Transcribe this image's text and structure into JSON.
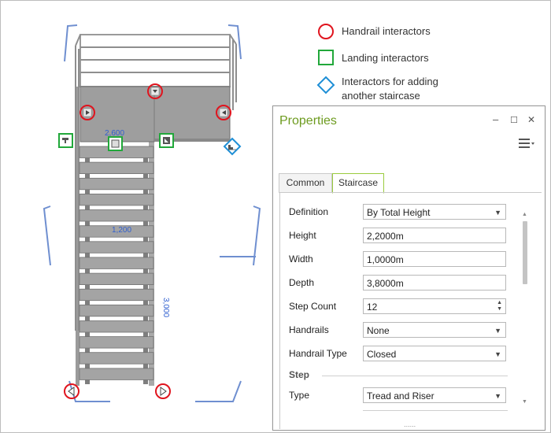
{
  "legend": {
    "handrail": "Handrail interactors",
    "landing": "Landing interactors",
    "add_line1": "Interactors for adding",
    "add_line2": "another staircase"
  },
  "dimensions": {
    "landing_width": "2,600",
    "stair_width": "1,200",
    "stair_length": "3,000"
  },
  "panel": {
    "title": "Properties",
    "minimize": "–",
    "maximize": "☐",
    "close": "✕",
    "tabs": [
      {
        "label": "Common",
        "active": false
      },
      {
        "label": "Staircase",
        "active": true
      }
    ],
    "rows": [
      {
        "label": "Definition",
        "value": "By Total Height",
        "control": "dropdown"
      },
      {
        "label": "Height",
        "value": "2,2000m",
        "control": "text"
      },
      {
        "label": "Width",
        "value": "1,0000m",
        "control": "text"
      },
      {
        "label": "Depth",
        "value": "3,8000m",
        "control": "text"
      },
      {
        "label": "Step Count",
        "value": "12",
        "control": "spinner"
      },
      {
        "label": "Handrails",
        "value": "None",
        "control": "dropdown"
      },
      {
        "label": "Handrail Type",
        "value": "Closed",
        "control": "dropdown"
      }
    ],
    "section": "Step",
    "section_rows": [
      {
        "label": "Type",
        "value": "Tread and Riser",
        "control": "dropdown"
      }
    ]
  },
  "colors": {
    "handrail_marker": "#e0141e",
    "landing_marker": "#21a83a",
    "add_marker": "#1f8fd6",
    "panel_title": "#6d9b1f",
    "tab_accent": "#9acb3e",
    "dimension_text": "#2f5fd0",
    "bracket": "#6f8fd0"
  }
}
